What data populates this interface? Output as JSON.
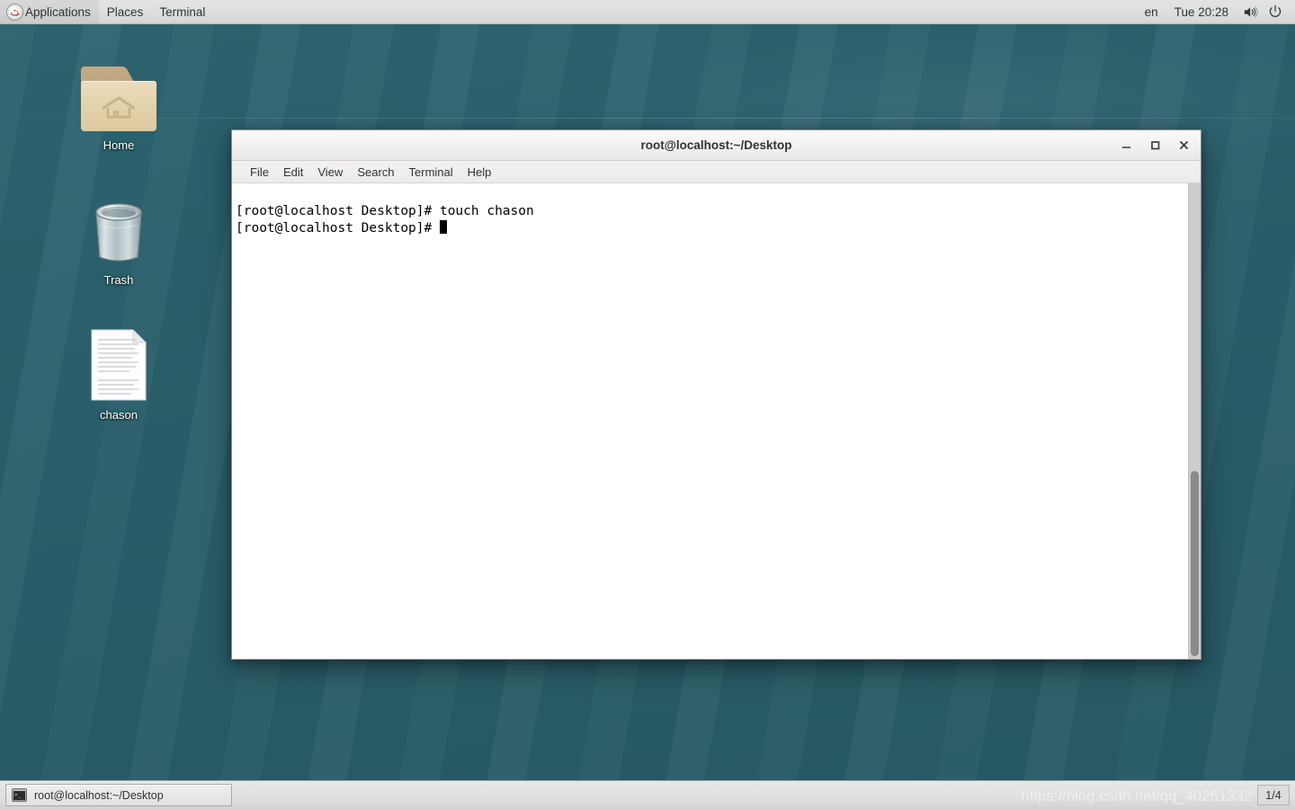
{
  "top_panel": {
    "menus": [
      {
        "label": "Applications",
        "icon": "redhat-logo-icon"
      },
      {
        "label": "Places"
      },
      {
        "label": "Terminal"
      }
    ],
    "keyboard_layout": "en",
    "clock": "Tue 20:28",
    "sound_icon": "speaker-icon",
    "power_icon": "power-icon"
  },
  "desktop": {
    "icons": [
      {
        "label": "Home",
        "icon": "home-folder-icon"
      },
      {
        "label": "Trash",
        "icon": "trash-bin-icon"
      },
      {
        "label": "chason",
        "icon": "text-document-icon"
      }
    ]
  },
  "terminal": {
    "title": "root@localhost:~/Desktop",
    "menus": [
      "File",
      "Edit",
      "View",
      "Search",
      "Terminal",
      "Help"
    ],
    "window_buttons": {
      "minimize": "minimize-icon",
      "maximize": "maximize-icon",
      "close": "close-icon"
    },
    "lines": [
      "[root@localhost Desktop]# touch chason",
      "[root@localhost Desktop]# "
    ],
    "prompt": "[root@localhost Desktop]# ",
    "background_color": "#ffffff",
    "foreground_color": "#000000"
  },
  "bottom_panel": {
    "task_button": {
      "label": "root@localhost:~/Desktop",
      "icon": "terminal-icon"
    },
    "workspace": "1/4",
    "watermark": "https://blog.csdn.net/qq_40261332"
  }
}
